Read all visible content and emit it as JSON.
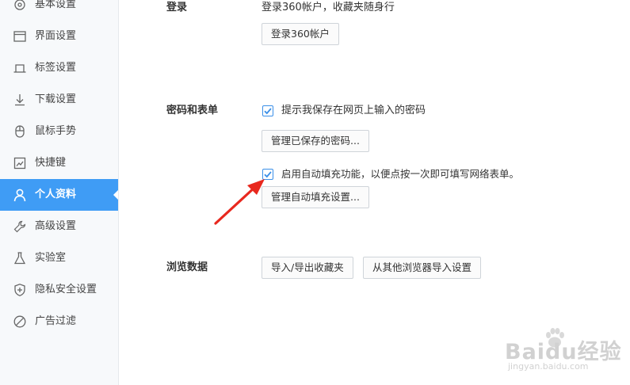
{
  "sidebar": {
    "items": [
      {
        "label": "基本设置",
        "icon": "gear-icon"
      },
      {
        "label": "界面设置",
        "icon": "window-icon"
      },
      {
        "label": "标签设置",
        "icon": "tab-icon"
      },
      {
        "label": "下载设置",
        "icon": "download-icon"
      },
      {
        "label": "鼠标手势",
        "icon": "mouse-icon"
      },
      {
        "label": "快捷键",
        "icon": "shortcut-icon"
      },
      {
        "label": "个人资料",
        "icon": "user-icon",
        "active": true
      },
      {
        "label": "高级设置",
        "icon": "wrench-icon"
      },
      {
        "label": "实验室",
        "icon": "flask-icon"
      },
      {
        "label": "隐私安全设置",
        "icon": "shield-icon"
      },
      {
        "label": "广告过滤",
        "icon": "block-icon"
      }
    ]
  },
  "login": {
    "title": "登录",
    "description": "登录360帐户，收藏夹随身行",
    "button": "登录360帐户"
  },
  "passwords": {
    "title": "密码和表单",
    "save_prompt_label": "提示我保存在网页上输入的密码",
    "save_prompt_checked": true,
    "manage_passwords_button": "管理已保存的密码...",
    "autofill_label": "启用自动填充功能，以便点按一次即可填写网络表单。",
    "autofill_checked": true,
    "manage_autofill_button": "管理自动填充设置..."
  },
  "browsing_data": {
    "title": "浏览数据",
    "import_export_button": "导入/导出收藏夹",
    "import_other_button": "从其他浏览器导入设置"
  },
  "annotation": {
    "color": "#e8281e"
  },
  "watermark": {
    "brand": "Baidu经验",
    "url": "jingyan.baidu.com"
  },
  "colors": {
    "accent": "#3f9cf5",
    "checkbox": "#3a8fe8"
  }
}
